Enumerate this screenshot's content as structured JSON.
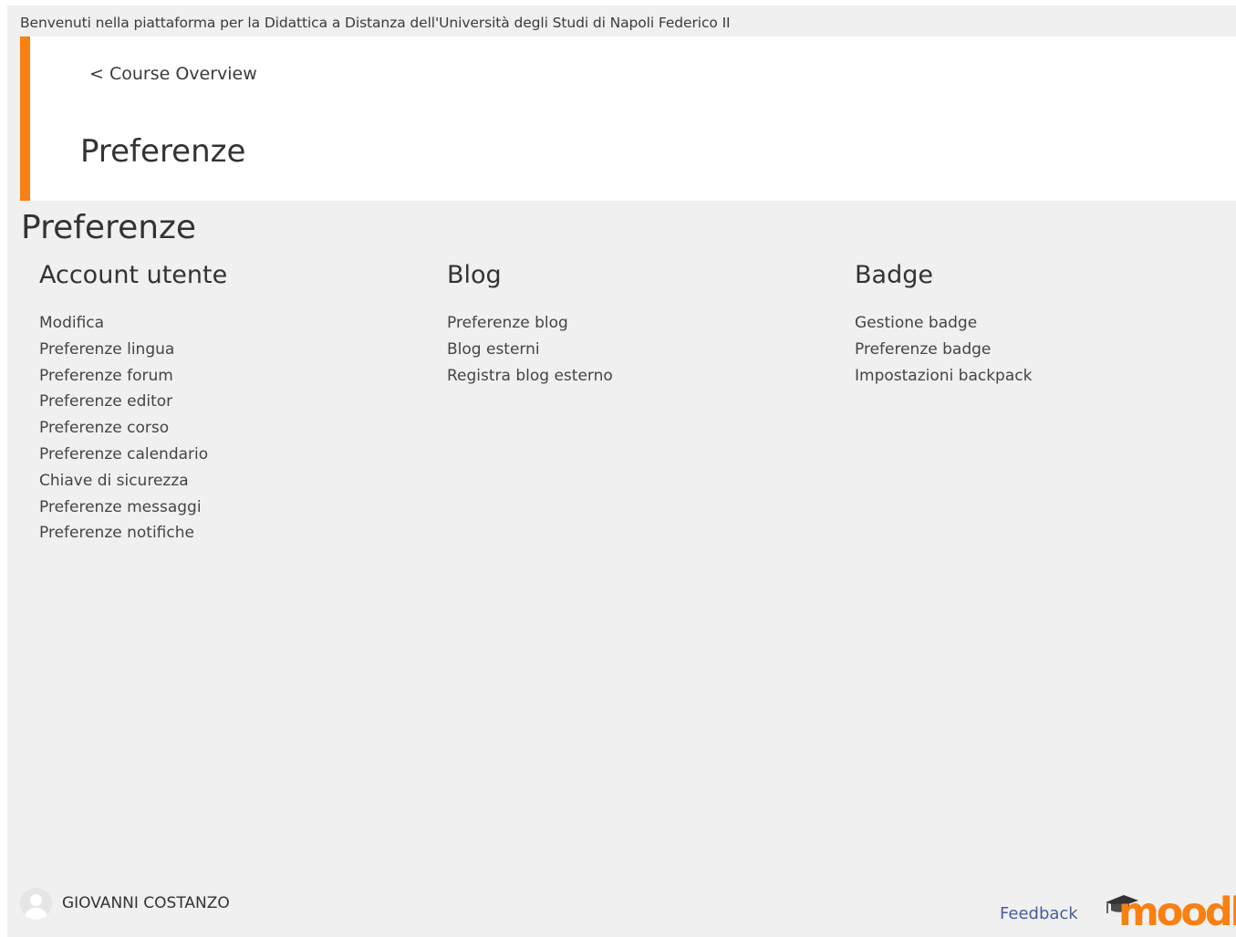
{
  "site": {
    "welcome_text": "Benvenuti nella piattaforma per la Didattica a Distanza dell'Università degli Studi di Napoli Federico II"
  },
  "header": {
    "back_link": "< Course Overview",
    "title": "Preferenze"
  },
  "main": {
    "title": "Preferenze",
    "sections": [
      {
        "title": "Account utente",
        "links": [
          "Modifica",
          "Preferenze lingua",
          "Preferenze forum",
          "Preferenze editor",
          "Preferenze corso",
          "Preferenze calendario",
          "Chiave di sicurezza",
          "Preferenze messaggi",
          "Preferenze notifiche"
        ]
      },
      {
        "title": "Blog",
        "links": [
          "Preferenze blog",
          "Blog esterni",
          "Registra blog esterno"
        ]
      },
      {
        "title": "Badge",
        "links": [
          "Gestione badge",
          "Preferenze badge",
          "Impostazioni backpack"
        ]
      }
    ]
  },
  "footer": {
    "user_name": "GIOVANNI COSTANZO",
    "feedback_label": "Feedback",
    "logo_text": "moodle",
    "avatar_icon": "user-avatar-icon",
    "logo_icon": "moodle-logo"
  },
  "colors": {
    "accent": "#f98012",
    "background": "#f0f0f0",
    "link": "#444444",
    "feedback": "#4a5b9a"
  }
}
